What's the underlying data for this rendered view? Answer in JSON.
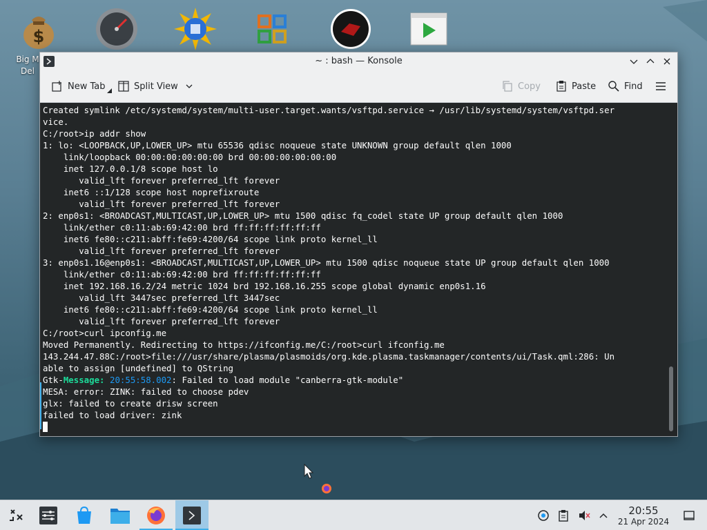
{
  "desktop": {
    "icon_label": "Big M\nDel"
  },
  "window": {
    "title": "~ : bash — Konsole"
  },
  "toolbar": {
    "new_tab": "New Tab",
    "split_view": "Split View",
    "copy": "Copy",
    "paste": "Paste",
    "find": "Find"
  },
  "terminal": {
    "lines": [
      "Created symlink /etc/systemd/system/multi-user.target.wants/vsftpd.service → /usr/lib/systemd/system/vsftpd.ser",
      "vice.",
      "C:/root>ip addr show",
      "1: lo: <LOOPBACK,UP,LOWER_UP> mtu 65536 qdisc noqueue state UNKNOWN group default qlen 1000",
      "    link/loopback 00:00:00:00:00:00 brd 00:00:00:00:00:00",
      "    inet 127.0.0.1/8 scope host lo",
      "       valid_lft forever preferred_lft forever",
      "    inet6 ::1/128 scope host noprefixroute",
      "       valid_lft forever preferred_lft forever",
      "2: enp0s1: <BROADCAST,MULTICAST,UP,LOWER_UP> mtu 1500 qdisc fq_codel state UP group default qlen 1000",
      "    link/ether c0:11:ab:69:42:00 brd ff:ff:ff:ff:ff:ff",
      "    inet6 fe80::c211:abff:fe69:4200/64 scope link proto kernel_ll",
      "       valid_lft forever preferred_lft forever",
      "3: enp0s1.16@enp0s1: <BROADCAST,MULTICAST,UP,LOWER_UP> mtu 1500 qdisc noqueue state UP group default qlen 1000",
      "    link/ether c0:11:ab:69:42:00 brd ff:ff:ff:ff:ff:ff",
      "    inet 192.168.16.2/24 metric 1024 brd 192.168.16.255 scope global dynamic enp0s1.16",
      "       valid_lft 3447sec preferred_lft 3447sec",
      "    inet6 fe80::c211:abff:fe69:4200/64 scope link proto kernel_ll",
      "       valid_lft forever preferred_lft forever",
      "C:/root>curl ipconfig.me",
      "Moved Permanently. Redirecting to https://ifconfig.me/C:/root>curl ifconfig.me",
      "143.244.47.88C:/root>file:///usr/share/plasma/plasmoids/org.kde.plasma.taskmanager/contents/ui/Task.qml:286: Un",
      "able to assign [undefined] to QString"
    ],
    "gtk_prefix": "Gtk-",
    "gtk_message": "Message:",
    "gtk_time": "20:55:58.002",
    "gtk_rest": ": Failed to load module \"canberra-gtk-module\"",
    "tail_lines": [
      "MESA: error: ZINK: failed to choose pdev",
      "glx: failed to create drisw screen",
      "failed to load driver: zink"
    ]
  },
  "clock": {
    "time": "20:55",
    "date": "21 Apr 2024"
  },
  "colors": {
    "terminal_bg": "#232627",
    "accent": "#3daee9",
    "gtk_message": "#1cdc9a",
    "gtk_time": "#1d99f3"
  }
}
